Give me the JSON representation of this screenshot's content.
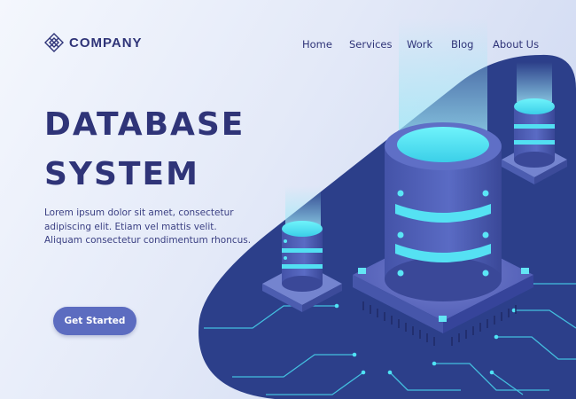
{
  "brand": {
    "name": "COMPANY",
    "logo_icon": "diamond-grid-icon"
  },
  "nav": {
    "items": [
      {
        "label": "Home"
      },
      {
        "label": "Services"
      },
      {
        "label": "Work"
      },
      {
        "label": "Blog"
      },
      {
        "label": "About Us"
      }
    ]
  },
  "hero": {
    "title_line1": "DATABASE",
    "title_line2": "SYSTEM",
    "description_lines": [
      "Lorem ipsum dolor sit amet, consectetur",
      "adipiscing elit. Etiam vel mattis velit.",
      "Aliquam consectetur condimentum rhoncus."
    ],
    "cta_label": "Get Started"
  },
  "colors": {
    "text_primary": "#2f3478",
    "button": "#5c6cc0",
    "panel_dark": "#2c3f8a",
    "glow": "#49e5f5"
  }
}
